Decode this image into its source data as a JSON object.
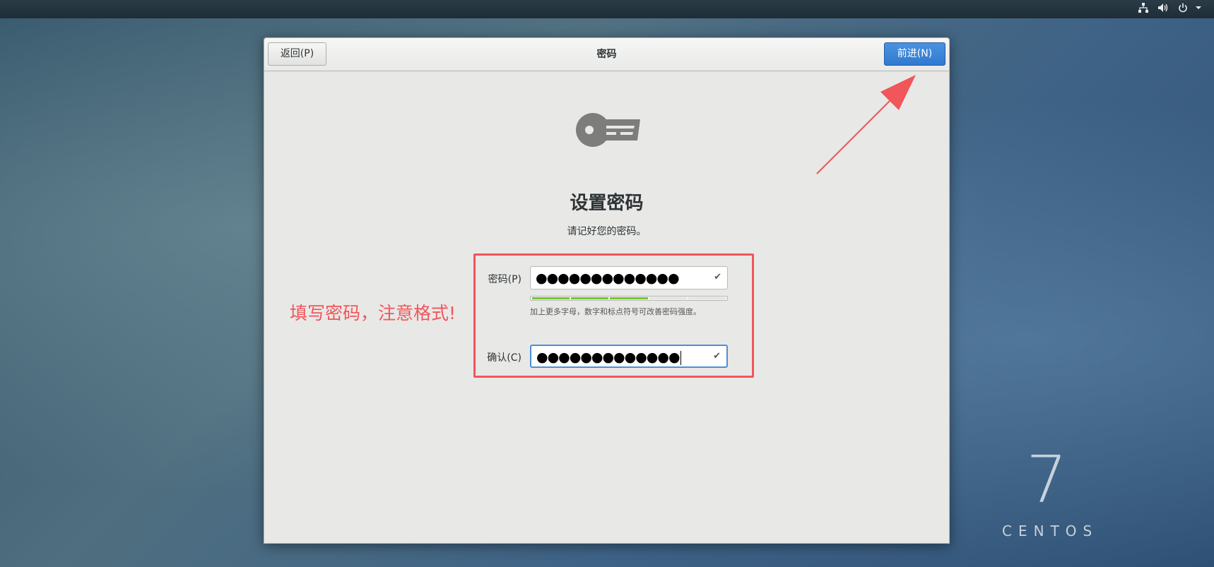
{
  "topbar": {
    "icons": [
      "network-icon",
      "volume-icon",
      "power-icon",
      "chevron-down-icon"
    ]
  },
  "header": {
    "back_label": "返回(P)",
    "title": "密码",
    "next_label": "前进(N)"
  },
  "main": {
    "heading": "设置密码",
    "subheading": "请记好您的密码。",
    "password_label": "密码(P)",
    "password_value": "●●●●●●●●●●●●●",
    "strength_level": 0.6,
    "strength_hint": "加上更多字母，数字和标点符号可改善密码强度。",
    "confirm_label": "确认(C)",
    "confirm_value": "●●●●●●●●●●●●●"
  },
  "annotation": {
    "text": "填写密码，注意格式!",
    "color": "#f0565a"
  },
  "brand": {
    "version": "7",
    "name": "CENTOS"
  },
  "colors": {
    "accent": "#2f79d0",
    "strength_bar": "#73c630",
    "annotation": "#f0565a"
  }
}
